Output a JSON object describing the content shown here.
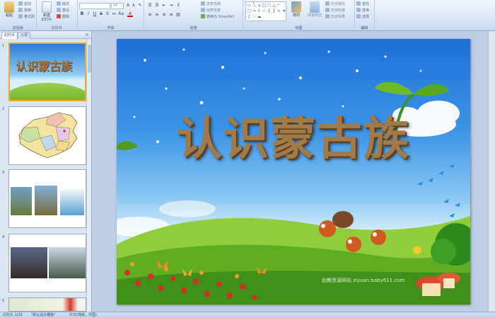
{
  "ribbon": {
    "clipboard": {
      "paste": "粘贴",
      "cut": "剪切",
      "copy": "复制",
      "painter": "格式刷",
      "title": "剪贴板"
    },
    "slides": {
      "new_slide": "新建\n幻灯片",
      "layout": "版式",
      "reset": "重设",
      "delete": "删除",
      "title": "幻灯片"
    },
    "font": {
      "size": "44",
      "title": "字体"
    },
    "paragraph": {
      "direction": "文字方向",
      "align": "对齐文本",
      "smartart": "转换为 SmartArt",
      "title": "段落"
    },
    "drawing": {
      "arrange": "排列",
      "quick_styles": "快速样式",
      "fill": "形状填充",
      "outline": "形状轮廓",
      "effects": "形状效果",
      "title": "绘图"
    },
    "editing": {
      "find": "查找",
      "replace": "替换",
      "select": "选择",
      "title": "编辑"
    }
  },
  "panel": {
    "tab_slides": "幻灯片",
    "tab_outline": "大纲",
    "thumbs": [
      {
        "num": "1",
        "title": "认识蒙古族"
      },
      {
        "num": "2"
      },
      {
        "num": "3"
      },
      {
        "num": "4"
      },
      {
        "num": "5"
      }
    ]
  },
  "slide": {
    "title": "认识蒙古族",
    "watermark": "幼教资源网站 ziyuan.baby611.com"
  },
  "status": {
    "slide_count": "幻灯片 1/25",
    "theme": "\"默认设计模板\"",
    "language": "中文(简体，中国)"
  }
}
